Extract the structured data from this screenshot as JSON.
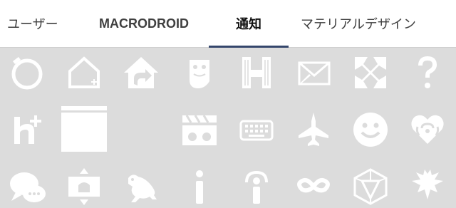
{
  "tabs": [
    {
      "label": "ユーザー",
      "active": false
    },
    {
      "label": "MACRODROID",
      "active": false
    },
    {
      "label": "通知",
      "active": true
    },
    {
      "label": "マテリアルデザイン",
      "active": false
    }
  ],
  "colors": {
    "tab_background": "#ffffff",
    "tab_text": "#404040",
    "active_indicator": "#34466b",
    "grid_background": "#dcdcdc",
    "icon_color": "#ffffff"
  },
  "icons": [
    "alarm-ring-icon",
    "home-outline-icon",
    "home-share-icon",
    "ghost-icon",
    "hangouts-h-icon",
    "envelope-icon",
    "xbox-logo-icon",
    "question-mark-icon",
    "hangouts-plus-icon",
    "calendar-blank-icon",
    "",
    "",
    "clapperboard-cats-icon",
    "keyboard-icon",
    "fighter-jet-icon",
    "smiley-face-icon",
    "iheart-radio-icon",
    "chat-bubbles-icon",
    "android-resize-icon",
    "frog-icon",
    "info-i-icon",
    "info-signal-icon",
    "infinity-icon",
    "ingress-icon",
    "dragon-icon"
  ]
}
